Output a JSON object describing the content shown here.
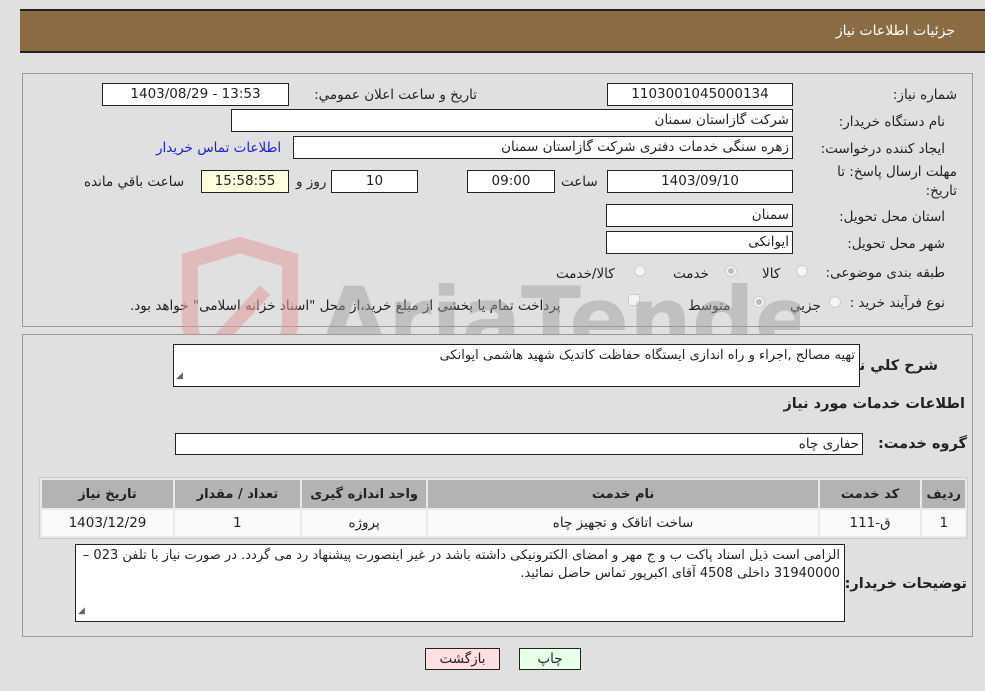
{
  "header": {
    "title": "جزئیات اطلاعات نیاز"
  },
  "form": {
    "need_number": {
      "label": "شماره نیاز:",
      "value": "1103001045000134"
    },
    "announce_datetime": {
      "label": "تاریخ و ساعت اعلان عمومي:",
      "value": "1403/08/29 - 13:53"
    },
    "buyer_org": {
      "label": "نام دستگاه خریدار:",
      "value": "شرکت گازاستان سمنان"
    },
    "requester": {
      "label": "ایجاد کننده درخواست:",
      "value": "زهره سنگی خدمات دفتری شرکت گازاستان سمنان"
    },
    "buyer_contact_link": "اطلاعات تماس خریدار",
    "deadline": {
      "label": "مهلت ارسال پاسخ: تا تاریخ:",
      "date": "1403/09/10",
      "time_label": "ساعت",
      "time": "09:00",
      "days": "10",
      "days_label": "روز و",
      "remaining_time": "15:58:55",
      "remaining_label": "ساعت باقي مانده"
    },
    "province": {
      "label": "استان محل تحویل:",
      "value": "سمنان"
    },
    "city": {
      "label": "شهر محل تحویل:",
      "value": "ایوانکی"
    },
    "category": {
      "label": "طبقه بندی موضوعی:",
      "options": [
        {
          "label": "کالا",
          "checked": false
        },
        {
          "label": "خدمت",
          "checked": true
        },
        {
          "label": "کالا/خدمت",
          "checked": false
        }
      ]
    },
    "purchase_type": {
      "label": "نوع فرآیند خرید :",
      "options": [
        {
          "label": "جزیي",
          "checked": false
        },
        {
          "label": "متوسط",
          "checked": true
        }
      ],
      "treasury_checkbox_label": "پرداخت تمام یا بخشی از مبلغ خرید،از محل \"اسناد خزانه اسلامی\" خواهد بود.",
      "treasury_checked": false
    }
  },
  "details": {
    "description_label": "شرح كلي نياز:",
    "description": "تهیه مصالح ,اجراء و راه اندازی ایستگاه حفاظت کاتدیک شهید هاشمی ایوانکی",
    "services_heading": "اطلاعات خدمات مورد نیاز",
    "service_group_label": "گروه خدمت:",
    "service_group": "حفاری چاه",
    "table": {
      "headers": [
        "ردیف",
        "کد خدمت",
        "نام خدمت",
        "واحد اندازه گیری",
        "تعداد / مقدار",
        "تاریخ نیاز"
      ],
      "rows": [
        [
          "1",
          "ق-111",
          "ساخت اتاقک و تجهیز چاه",
          "پروژه",
          "1",
          "1403/12/29"
        ]
      ]
    },
    "buyer_notes_label": "توضیحات خریدار:",
    "buyer_notes": "الزامی است ذیل اسناد پاکت ب و ج مهر و امضای الکترونیکی داشته باشد در غیر اینصورت پیشنهاد رد می گردد. در صورت نیاز با تلفن 023 – 31940000  داخلی 4508  آقای اکبرپور تماس حاصل نمائید."
  },
  "buttons": {
    "print": "چاپ",
    "back": "بازگشت"
  },
  "watermark": {
    "text": "AriaTender.neT"
  }
}
